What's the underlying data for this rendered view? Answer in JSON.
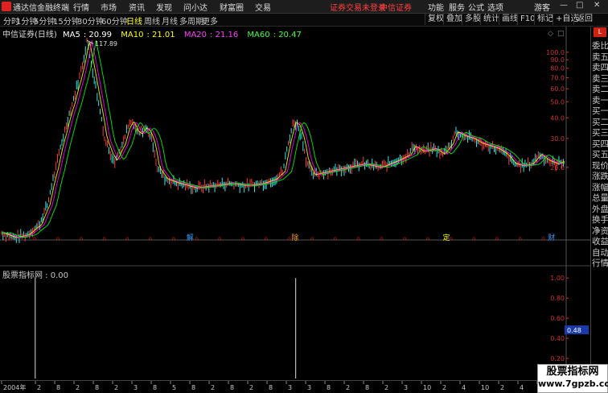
{
  "app": {
    "title": "通达信金融终端",
    "menus": [
      "行情",
      "市场",
      "资讯",
      "发现",
      "问小达",
      "财富圈",
      "交易"
    ],
    "notice": "证券交易未登录",
    "broker": "中信证券",
    "right_menus": [
      "功能",
      "服务",
      "公式",
      "选项"
    ],
    "guest": "游客"
  },
  "toolbar": {
    "periods": [
      "分时",
      "1分钟",
      "5分钟",
      "15分钟",
      "30分钟",
      "60分钟",
      "日线",
      "周线",
      "月线",
      "多周期",
      "更多"
    ],
    "active_period": "日线",
    "buttons": [
      "复权",
      "叠加",
      "多股",
      "统计",
      "画线",
      "F10",
      "标记",
      "+自选",
      "返回"
    ]
  },
  "chart_data": {
    "type": "line",
    "title": "中信证券(日线)",
    "ma": [
      {
        "name": "MA5",
        "value": "20.99",
        "color": "#ffffff"
      },
      {
        "name": "MA10",
        "value": "21.01",
        "color": "#ffff00"
      },
      {
        "name": "MA20",
        "value": "21.16",
        "color": "#ff00ff"
      },
      {
        "name": "MA60",
        "value": "20.47",
        "color": "#00ff00"
      }
    ],
    "y_ticks": [
      "100.0",
      "90.0",
      "80.0",
      "70.0",
      "60.0",
      "50.0",
      "40.0",
      "30.0",
      "20.0"
    ],
    "yscale": "log",
    "ylim": [
      7.5,
      125
    ],
    "peak_label": "117.89",
    "price_points": [
      [
        0,
        8
      ],
      [
        3,
        7.5
      ],
      [
        6,
        7.8
      ],
      [
        9,
        9
      ],
      [
        11,
        12
      ],
      [
        13,
        20
      ],
      [
        15,
        33
      ],
      [
        17,
        50
      ],
      [
        18.5,
        70
      ],
      [
        19.5,
        90
      ],
      [
        20.3,
        117.89
      ],
      [
        21,
        95
      ],
      [
        22,
        70
      ],
      [
        23,
        50
      ],
      [
        24.5,
        30
      ],
      [
        26,
        24
      ],
      [
        27,
        22
      ],
      [
        29,
        28
      ],
      [
        30,
        35
      ],
      [
        31,
        38
      ],
      [
        32,
        33
      ],
      [
        33,
        32
      ],
      [
        34,
        35
      ],
      [
        35,
        33
      ],
      [
        36,
        28
      ],
      [
        37,
        20
      ],
      [
        39,
        17
      ],
      [
        42,
        16
      ],
      [
        46,
        15
      ],
      [
        50,
        15.5
      ],
      [
        54,
        16
      ],
      [
        58,
        15.5
      ],
      [
        62,
        16
      ],
      [
        65,
        17
      ],
      [
        67,
        19
      ],
      [
        68.5,
        30
      ],
      [
        69.5,
        38
      ],
      [
        70.5,
        36
      ],
      [
        71.5,
        30
      ],
      [
        72.5,
        22
      ],
      [
        74,
        18
      ],
      [
        78,
        19
      ],
      [
        82,
        20
      ],
      [
        86,
        21
      ],
      [
        90,
        20
      ],
      [
        94,
        22
      ],
      [
        97,
        24
      ],
      [
        98,
        27
      ],
      [
        100,
        25
      ],
      [
        103,
        26
      ],
      [
        105,
        24
      ],
      [
        107,
        28
      ],
      [
        108,
        33
      ],
      [
        110,
        31
      ],
      [
        112,
        30
      ],
      [
        114,
        28
      ],
      [
        116,
        27
      ],
      [
        118,
        26
      ],
      [
        120,
        24
      ],
      [
        122,
        21
      ],
      [
        124,
        20.5
      ],
      [
        126,
        21
      ],
      [
        128,
        24
      ],
      [
        130,
        22
      ],
      [
        132,
        21
      ],
      [
        134,
        22
      ]
    ],
    "x_max": 134,
    "indicator": {
      "title": "股票指标网 : 0.00",
      "y_ticks": [
        "1.00",
        "0.80",
        "0.60",
        "0.40",
        "0.20"
      ],
      "ylim": [
        0,
        1.05
      ],
      "current_label": "0.48",
      "spikes": [
        8,
        70
      ]
    },
    "events": [
      {
        "x": 44,
        "label": "解",
        "color": "#3399ff"
      },
      {
        "x": 69,
        "label": "除",
        "color": "#ff9900"
      },
      {
        "x": 105,
        "label": "定",
        "color": "#ffff00"
      },
      {
        "x": 130,
        "label": "财",
        "color": "#3399ff"
      }
    ],
    "x_labels": [
      "2004年",
      "2",
      "8",
      "2",
      "8",
      "2",
      "3",
      "8",
      "5",
      "8",
      "2",
      "8",
      "2",
      "8",
      "3",
      "3",
      "8",
      "2",
      "8",
      "2",
      "3",
      "10",
      "2",
      "4",
      "10",
      "2",
      "4",
      "10",
      "4"
    ]
  },
  "side_panel": {
    "badge": "L",
    "items": [
      "委比",
      "卖五",
      "卖四",
      "卖三",
      "卖二",
      "卖一",
      "买一",
      "买二",
      "买三",
      "买四",
      "买五",
      "现价",
      "涨跌",
      "涨幅",
      "总量",
      "外盘",
      "换手",
      "净资",
      "收益",
      "自动",
      "行情"
    ]
  },
  "watermark": {
    "line1": "股票指标网",
    "line2": "www.7gpzb.com"
  }
}
